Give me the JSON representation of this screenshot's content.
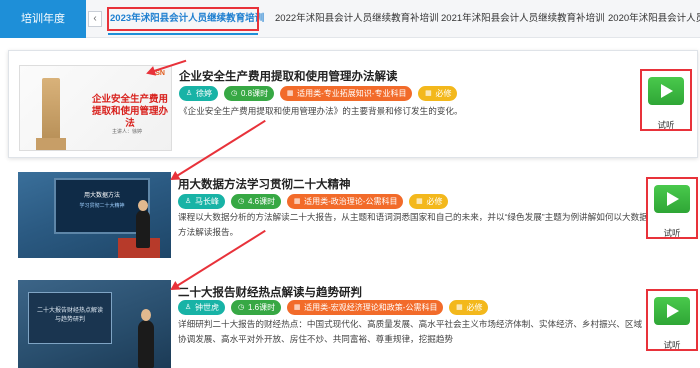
{
  "topbar": {
    "year_label": "培训年度",
    "prev_icon": "chevron-left-icon",
    "tabs": [
      {
        "label": "2023年沭阳县会计人员继续教育培训",
        "active": true
      },
      {
        "label": "2022年沭阳县会计人员继续教育补培训",
        "active": false
      },
      {
        "label": "2021年沭阳县会计人员继续教育补培训",
        "active": false
      },
      {
        "label": "2020年沭阳县会计人员继续教",
        "active": false
      }
    ]
  },
  "courses": [
    {
      "title": "企业安全生产费用提取和使用管理办法解读",
      "teacher": "徐婷",
      "hours": "0.8课时",
      "category": "适用类-专业拓展知识-专业科目",
      "required": "必修",
      "description": "《企业安全生产费用提取和使用管理办法》的主要背景和修订发生的变化。",
      "play_label": "试听",
      "thumb": {
        "logo": "SN",
        "title": "企业安全生产费用提取和使用管理办法",
        "author": "主讲人：徐婷"
      }
    },
    {
      "title": "用大数据方法学习贯彻二十大精神",
      "teacher": "马长峰",
      "hours": "4.6课时",
      "category": "适用类-政治理论-公需科目",
      "required": "必修",
      "description": "课程以大数据分析的方法解读二十大报告，从主题和语词洞悉国家和自己的未来，并以“绿色发展”主题为例讲解如何以大数据方法解读报告。",
      "play_label": "试听",
      "thumb": {
        "line1": "用大数据方法",
        "line2": "学习贯彻二十大精神"
      }
    },
    {
      "title": "二十大报告财经热点解读与趋势研判",
      "teacher": "钟世虎",
      "hours": "1.6课时",
      "category": "适用类-宏观经济理论和政策-公需科目",
      "required": "必修",
      "description": "详细研判二十大报告的财经热点：中国式现代化、高质量发展、高水平社会主义市场经济体制、实体经济、乡村振兴、区域协调发展、高水平对外开放、房住不炒、共同富裕、尊重规律，挖掘趋势",
      "play_label": "试听",
      "thumb": {
        "line1": "二十大报告财经热点解读",
        "line2": "与趋势研判"
      }
    }
  ],
  "colors": {
    "accent": "#1e8fd8",
    "annotation": "#e8323a",
    "teacher_badge": "#18b3a6",
    "hours_badge": "#37a844",
    "category_badge": "#f26b2a",
    "required_badge": "#f3b81c",
    "play": "#37b63d"
  },
  "icons": {
    "teacher": "user-icon",
    "hours": "clock-icon",
    "category": "grid-icon",
    "required": "grid-icon",
    "play": "play-icon"
  }
}
